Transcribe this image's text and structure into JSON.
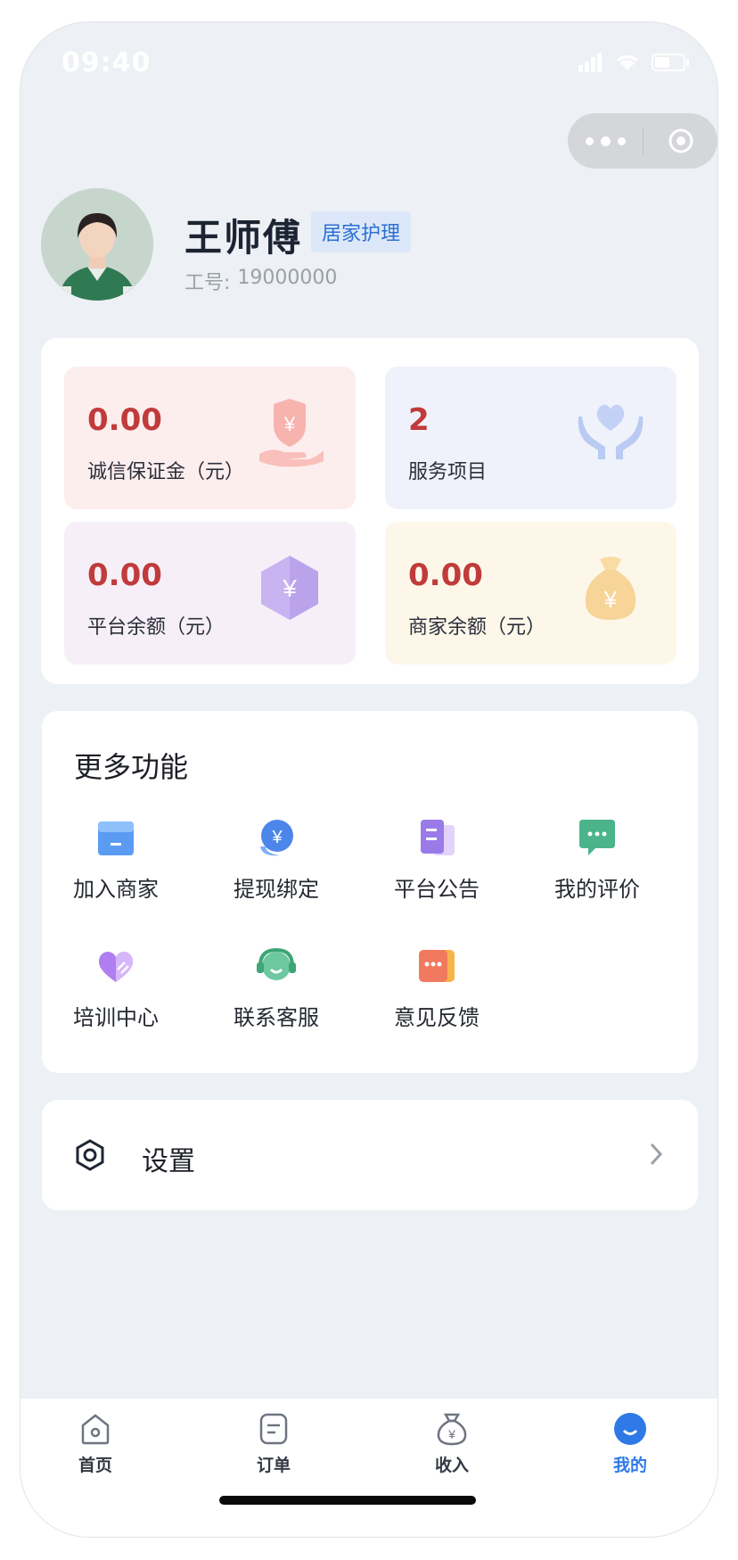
{
  "status_bar": {
    "time": "09:40"
  },
  "capsule": {
    "more_icon": "more-dots-icon",
    "close_icon": "target-circle-icon"
  },
  "profile": {
    "name": "王师傅",
    "tag": "居家护理",
    "id_label": "工号:",
    "id_value": "19000000"
  },
  "stats": [
    {
      "value": "0.00",
      "label": "诚信保证金（元）",
      "icon": "shield-yen-hand-icon",
      "color": "#c03b3b"
    },
    {
      "value": "2",
      "label": "服务项目",
      "icon": "heart-hands-icon",
      "color": "#c03b3b"
    },
    {
      "value": "0.00",
      "label": "平台余额（元）",
      "icon": "hexagon-yen-icon",
      "color": "#c03b3b"
    },
    {
      "value": "0.00",
      "label": "商家余额（元）",
      "icon": "money-bag-icon",
      "color": "#c03b3b"
    }
  ],
  "more": {
    "title": "更多功能",
    "items": [
      {
        "label": "加入商家",
        "icon": "store-icon"
      },
      {
        "label": "提现绑定",
        "icon": "yen-bubble-icon"
      },
      {
        "label": "平台公告",
        "icon": "notice-icon"
      },
      {
        "label": "我的评价",
        "icon": "comment-icon"
      },
      {
        "label": "培训中心",
        "icon": "training-heart-icon"
      },
      {
        "label": "联系客服",
        "icon": "headset-icon"
      },
      {
        "label": "意见反馈",
        "icon": "feedback-icon"
      }
    ]
  },
  "settings": {
    "label": "设置",
    "icon": "settings-hexagon-icon"
  },
  "tabbar": {
    "items": [
      {
        "label": "首页",
        "icon": "home-icon",
        "active": false
      },
      {
        "label": "订单",
        "icon": "order-icon",
        "active": false
      },
      {
        "label": "收入",
        "icon": "income-bag-icon",
        "active": false
      },
      {
        "label": "我的",
        "icon": "profile-icon",
        "active": true
      }
    ],
    "active_color": "#2f79e6"
  }
}
